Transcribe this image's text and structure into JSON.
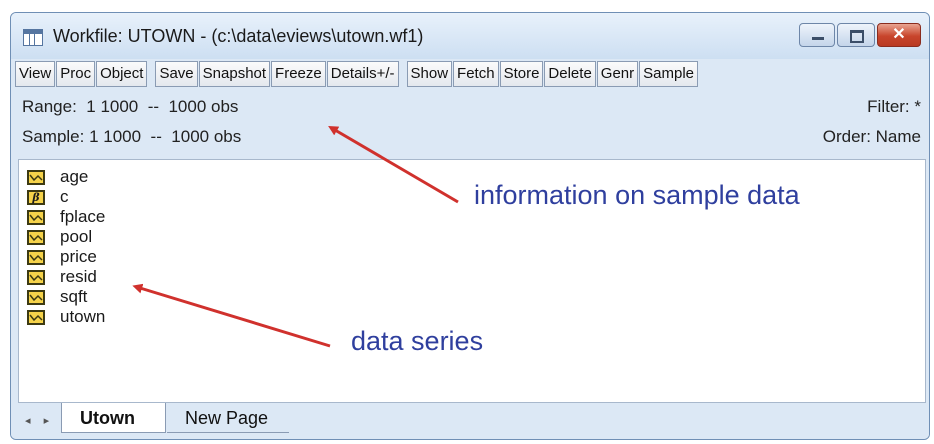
{
  "window": {
    "title": "Workfile: UTOWN - (c:\\data\\eviews\\utown.wf1)",
    "close_glyph": "✕"
  },
  "toolbar": {
    "buttons": [
      "View",
      "Proc",
      "Object",
      "Save",
      "Snapshot",
      "Freeze",
      "Details+/-",
      "Show",
      "Fetch",
      "Store",
      "Delete",
      "Genr",
      "Sample"
    ]
  },
  "info": {
    "range": "Range:  1 1000  --  1000 obs",
    "sample": "Sample: 1 1000  --  1000 obs",
    "filter": "Filter: *",
    "order": "Order: Name"
  },
  "objects": [
    {
      "name": "age",
      "icon": "series-icon"
    },
    {
      "name": "c",
      "icon": "coefficient-icon"
    },
    {
      "name": "fplace",
      "icon": "series-icon"
    },
    {
      "name": "pool",
      "icon": "series-icon"
    },
    {
      "name": "price",
      "icon": "series-icon"
    },
    {
      "name": "resid",
      "icon": "series-icon"
    },
    {
      "name": "sqft",
      "icon": "series-icon"
    },
    {
      "name": "utown",
      "icon": "series-icon"
    }
  ],
  "coef_glyph": "β",
  "annotations": {
    "info_note": "information on sample data",
    "series_note": "data series",
    "arrow_color": "#d0312d"
  },
  "tabs": {
    "nav": "◂ ▸",
    "active": "Utown",
    "new_page": "New Page"
  },
  "colors": {
    "window_bg": "#dce8f5",
    "annotation_text": "#2f3f9e",
    "icon_fill": "#f6d34a"
  }
}
